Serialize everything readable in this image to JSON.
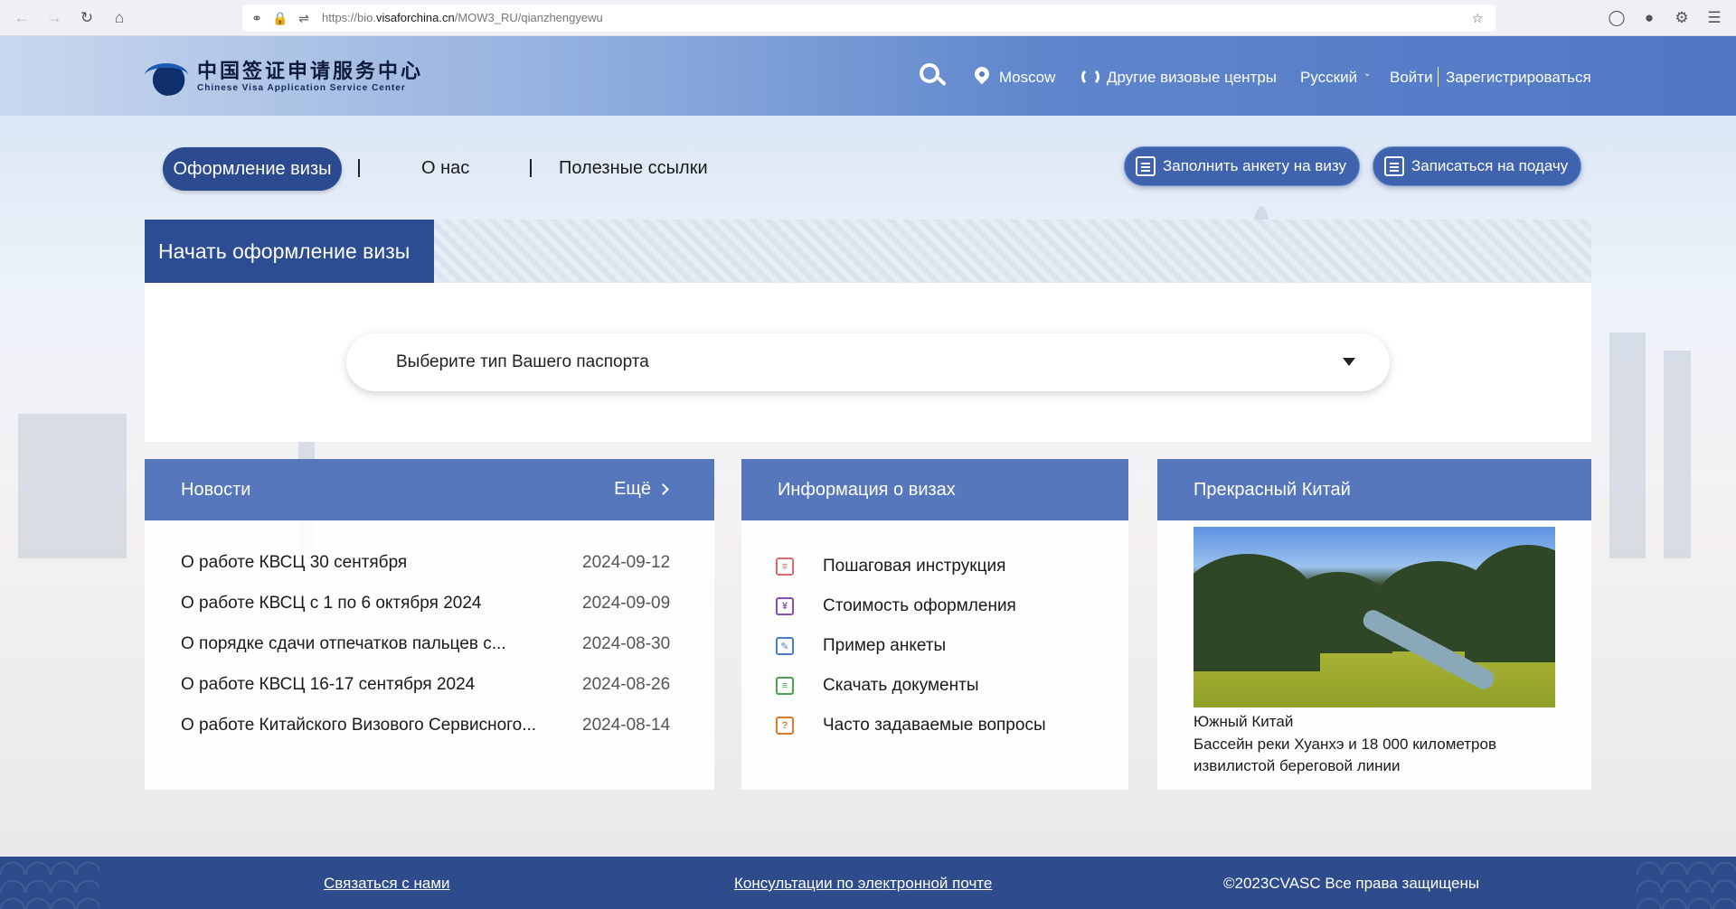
{
  "browser": {
    "url_prefix": "https://bio.",
    "url_domain": "visaforchina.cn",
    "url_path": "/MOW3_RU/qianzhengyewu"
  },
  "header": {
    "logo_cn": "中国签证申请服务中心",
    "logo_en": "Chinese Visa Application Service Center",
    "city": "Moscow",
    "other_centers": "Другие визовые центры",
    "language": "Русский",
    "login": "Войти",
    "register": "Зарегистрироваться"
  },
  "nav": {
    "active": "Оформление визы",
    "about": "О нас",
    "links": "Полезные ссылки",
    "fill_form": "Заполнить анкету на визу",
    "book": "Записаться на подачу"
  },
  "start": {
    "title": "Начать оформление визы",
    "passport_placeholder": "Выберите тип Вашего паспорта"
  },
  "news": {
    "title": "Новости",
    "more": "Ещё",
    "items": [
      {
        "title": "О работе КВСЦ 30 сентября",
        "date": "2024-09-12"
      },
      {
        "title": "О работе КВСЦ с 1 по 6 октября 2024",
        "date": "2024-09-09"
      },
      {
        "title": "О порядке сдачи отпечатков пальцев с...",
        "date": "2024-08-30"
      },
      {
        "title": "О работе КВСЦ 16-17 сентября 2024",
        "date": "2024-08-26"
      },
      {
        "title": "О работе Китайского Визового Сервисного...",
        "date": "2024-08-14"
      }
    ]
  },
  "visa_info": {
    "title": "Информация о визах",
    "items": [
      {
        "label": "Пошаговая инструкция",
        "icon": "checklist-icon",
        "color": "#e06a6a"
      },
      {
        "label": "Стоимость оформления",
        "icon": "yen-icon",
        "color": "#8a4fb5"
      },
      {
        "label": "Пример анкеты",
        "icon": "pen-icon",
        "color": "#4a7fd0"
      },
      {
        "label": "Скачать документы",
        "icon": "document-icon",
        "color": "#4da34d"
      },
      {
        "label": "Часто задаваемые вопросы",
        "icon": "question-chat-icon",
        "color": "#e07a2a"
      }
    ]
  },
  "china": {
    "title": "Прекрасный Китай",
    "caption_1": "Южный Китай",
    "caption_2": "Бассейн реки Хуанхэ и 18 000 километров",
    "caption_3": "извилистой береговой линии"
  },
  "footer": {
    "contact": "Связаться с нами",
    "email": "Консультации по электронной почте",
    "copyright": "©2023CVASC Все права защищены"
  }
}
